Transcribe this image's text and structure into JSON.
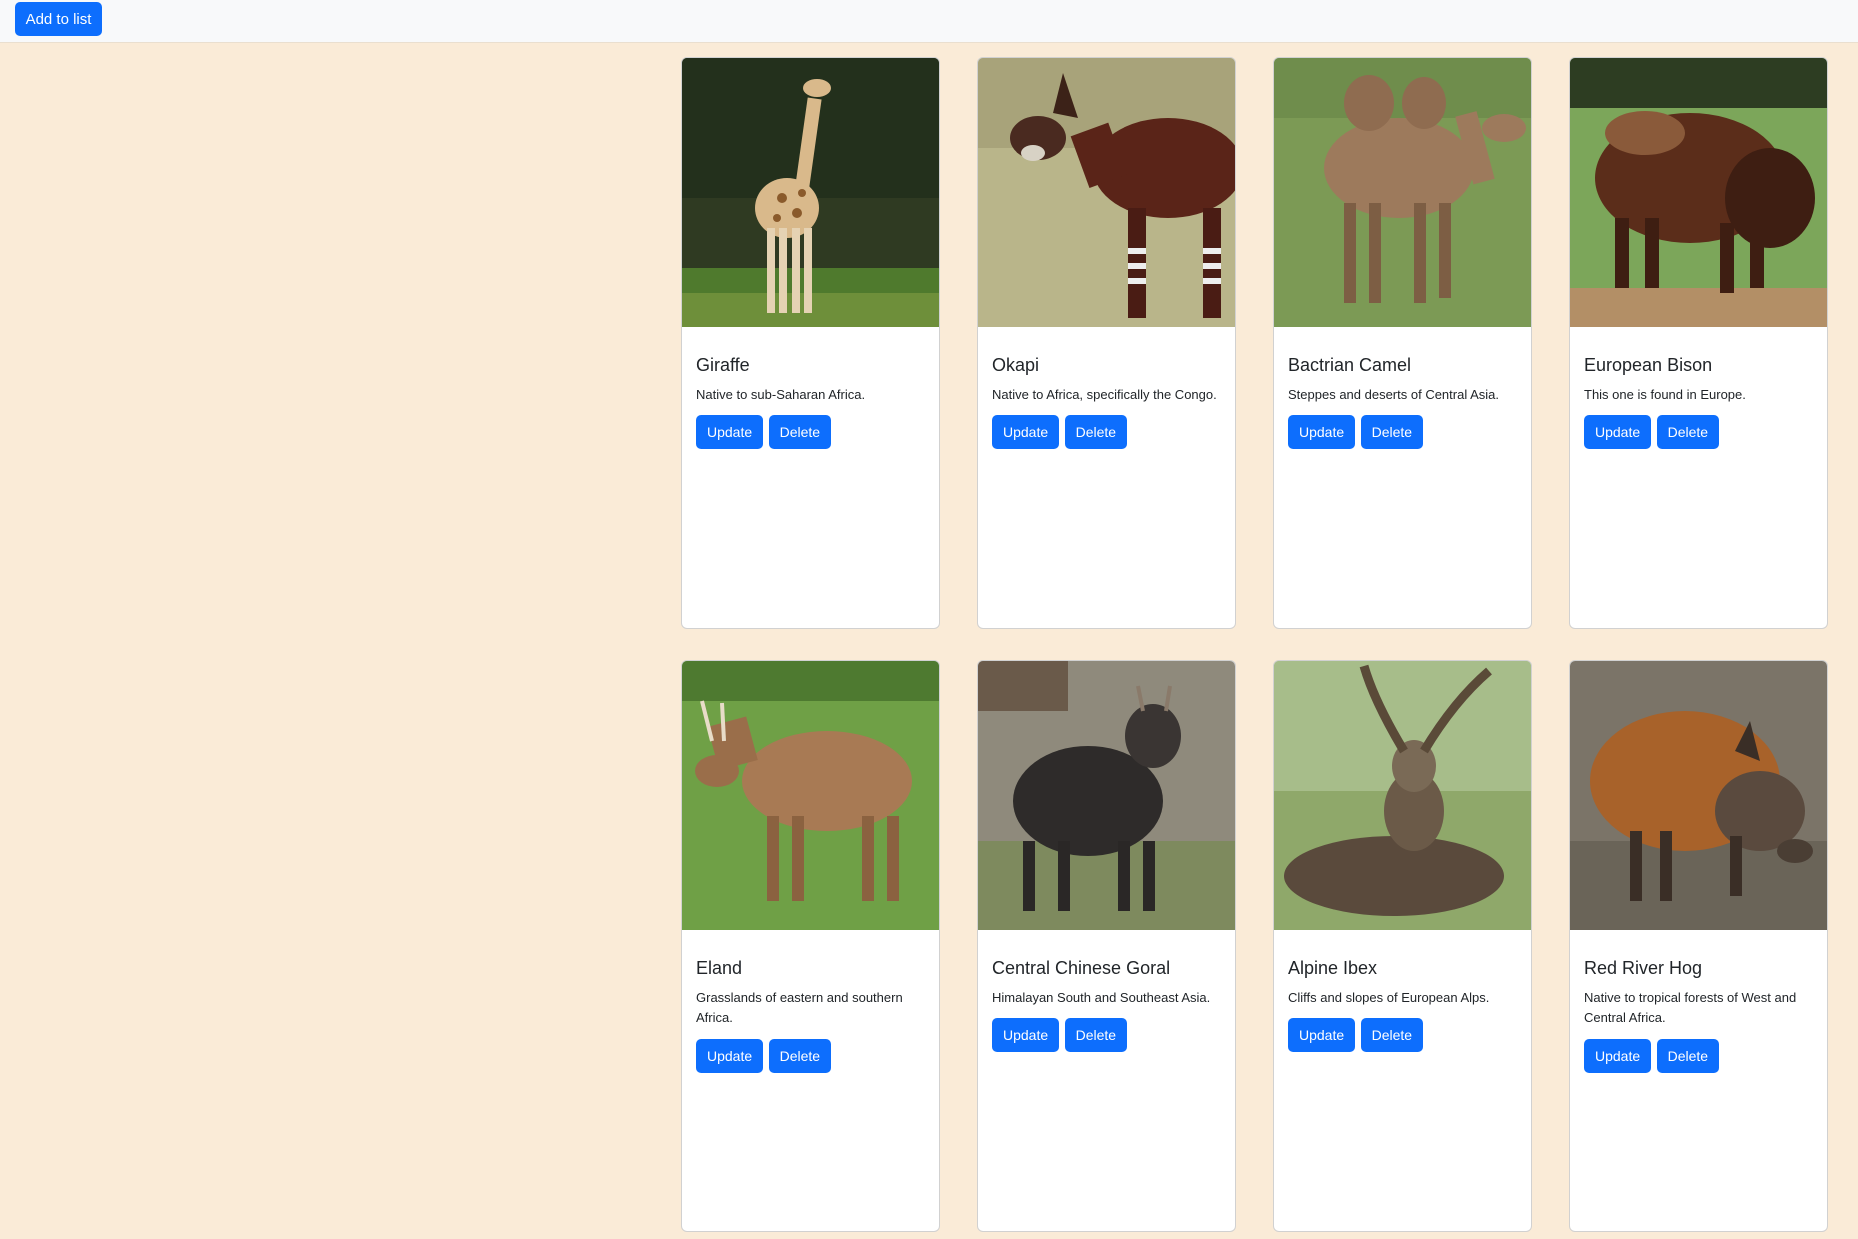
{
  "header": {
    "add_label": "Add to list"
  },
  "colors": {
    "page_bg": "#faebd7",
    "primary": "#0d6efd",
    "card_bg": "#ffffff"
  },
  "cards": [
    {
      "title": "Giraffe",
      "text": "Native to sub-Saharan Africa.",
      "update_label": "Update",
      "delete_label": "Delete"
    },
    {
      "title": "Okapi",
      "text": "Native to Africa, specifically the Congo.",
      "update_label": "Update",
      "delete_label": "Delete"
    },
    {
      "title": "Bactrian Camel",
      "text": "Steppes and deserts of Central Asia.",
      "update_label": "Update",
      "delete_label": "Delete"
    },
    {
      "title": "European Bison",
      "text": "This one is found in Europe.",
      "update_label": "Update",
      "delete_label": "Delete"
    },
    {
      "title": "Eland",
      "text": "Grasslands of eastern and southern Africa.",
      "update_label": "Update",
      "delete_label": "Delete"
    },
    {
      "title": "Central Chinese Goral",
      "text": "Himalayan South and Southeast Asia.",
      "update_label": "Update",
      "delete_label": "Delete"
    },
    {
      "title": "Alpine Ibex",
      "text": "Cliffs and slopes of European Alps.",
      "update_label": "Update",
      "delete_label": "Delete"
    },
    {
      "title": "Red River Hog",
      "text": "Native to tropical forests of West and Central Africa.",
      "update_label": "Update",
      "delete_label": "Delete"
    }
  ]
}
